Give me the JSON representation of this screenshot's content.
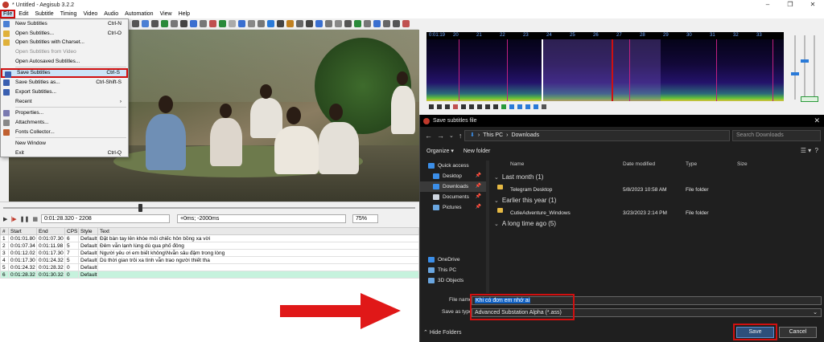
{
  "app": {
    "title": "* Untitled - Aegisub 3.2.2",
    "window_controls": [
      "–",
      "❐",
      "✕"
    ]
  },
  "menubar": [
    "File",
    "Edit",
    "Subtitle",
    "Timing",
    "Video",
    "Audio",
    "Automation",
    "View",
    "Help"
  ],
  "file_menu": [
    {
      "label": "New Subtitles",
      "shortcut": "Ctrl-N",
      "icon": "new-document-icon",
      "color": "#4a7fd4"
    },
    {
      "label": "Open Subtitles...",
      "shortcut": "Ctrl-O",
      "icon": "open-folder-icon",
      "color": "#e0b13a"
    },
    {
      "label": "Open Subtitles with Charset...",
      "shortcut": "",
      "icon": "open-charset-icon",
      "color": "#e0b13a"
    },
    {
      "label": "Open Subtitles from Video",
      "shortcut": "",
      "icon": "",
      "disabled": true
    },
    {
      "label": "Open Autosaved Subtitles...",
      "shortcut": "",
      "icon": ""
    },
    {
      "sep": true
    },
    {
      "label": "Save Subtitles",
      "shortcut": "Ctrl-S",
      "icon": "save-icon",
      "color": "#3a5fb0",
      "highlighted": true
    },
    {
      "label": "Save Subtitles as...",
      "shortcut": "Ctrl-Shift-S",
      "icon": "save-as-icon",
      "color": "#3a5fb0"
    },
    {
      "label": "Export Subtitles...",
      "shortcut": "",
      "icon": "export-icon",
      "color": "#3a5fb0"
    },
    {
      "label": "Recent",
      "shortcut": "›",
      "icon": ""
    },
    {
      "sep": true
    },
    {
      "label": "Properties...",
      "shortcut": "",
      "icon": "properties-icon",
      "color": "#7a7ab0"
    },
    {
      "label": "Attachments...",
      "shortcut": "",
      "icon": "attachment-icon",
      "color": "#888"
    },
    {
      "label": "Fonts Collector...",
      "shortcut": "",
      "icon": "fonts-icon",
      "color": "#c06030"
    },
    {
      "sep": true
    },
    {
      "label": "New Window",
      "shortcut": "",
      "icon": ""
    },
    {
      "label": "Exit",
      "shortcut": "Ctrl-Q",
      "icon": ""
    }
  ],
  "video_controls": {
    "time": "0:01:28.320 - 2208",
    "offset": "+0ms; -2000ms",
    "zoom": "75%"
  },
  "grid": {
    "headers": [
      "#",
      "Start",
      "End",
      "CPS",
      "Style",
      "Text"
    ],
    "rows": [
      [
        "1",
        "0:01:01.80",
        "0:01:07.30",
        "6",
        "Default",
        "Đặt bàn tay lên khóe môi chiếc hôn bồng xa vời"
      ],
      [
        "2",
        "0:01:07.34",
        "0:01:11.98",
        "5",
        "Default",
        "Đêm vẫn lạnh lùng dù qua phố đông"
      ],
      [
        "3",
        "0:01:12.02",
        "0:01:17.30",
        "7",
        "Default",
        "Người yêu ơi em biết không\\Nvẫn sâu đậm trong lòng"
      ],
      [
        "4",
        "0:01:17.30",
        "0:01:24.32",
        "5",
        "Default",
        "Dù thời gian trôi xa tình vẫn trao người thiết tha"
      ],
      [
        "5",
        "0:01:24.32",
        "0:01:28.32",
        "0",
        "Default",
        ""
      ],
      [
        "6",
        "0:01:28.32",
        "0:01:30.32",
        "0",
        "Default",
        ""
      ]
    ]
  },
  "audio": {
    "timeline_labels": [
      "0:01:19",
      "20",
      "21",
      "22",
      "23",
      "24",
      "25",
      "26",
      "27",
      "28",
      "29",
      "30",
      "31",
      "32",
      "33"
    ]
  },
  "dialog": {
    "title": "Save subtitles file",
    "path": [
      "This PC",
      "Downloads"
    ],
    "search_placeholder": "Search Downloads",
    "organize": "Organize ▾",
    "new_folder": "New folder",
    "nav_items": [
      {
        "label": "Quick access",
        "icon": "star-icon",
        "color": "#3b8ee8"
      },
      {
        "label": "Desktop",
        "icon": "desktop-icon",
        "color": "#3b8ee8",
        "pin": true
      },
      {
        "label": "Downloads",
        "icon": "download-icon",
        "color": "#3b8ee8",
        "pin": true,
        "selected": true
      },
      {
        "label": "Documents",
        "icon": "documents-icon",
        "color": "#cfd6e0",
        "pin": true
      },
      {
        "label": "Pictures",
        "icon": "pictures-icon",
        "color": "#6aa6e0",
        "pin": true
      },
      {
        "label": "",
        "icon": ""
      },
      {
        "label": "",
        "icon": ""
      },
      {
        "label": "",
        "icon": ""
      },
      {
        "label": "",
        "icon": ""
      },
      {
        "label": "OneDrive",
        "icon": "cloud-icon",
        "color": "#3b8ee8"
      },
      {
        "label": "This PC",
        "icon": "computer-icon",
        "color": "#6aa6e0"
      },
      {
        "label": "3D Objects",
        "icon": "cube-icon",
        "color": "#6aa6e0"
      }
    ],
    "columns": [
      "Name",
      "Date modified",
      "Type",
      "Size"
    ],
    "groups": [
      {
        "label": "Last month (1)",
        "files": [
          {
            "name": "Telegram Desktop",
            "date": "5/8/2023 10:58 AM",
            "type": "File folder"
          }
        ]
      },
      {
        "label": "Earlier this year (1)",
        "files": [
          {
            "name": "CutieAdventure_Windows",
            "date": "3/23/2023 2:14 PM",
            "type": "File folder"
          }
        ]
      },
      {
        "label": "A long time ago (5)",
        "files": []
      }
    ],
    "file_name_label": "File name:",
    "file_name_value": "Khi có đơn em nhớ ai",
    "save_type_label": "Save as type:",
    "save_type_value": "Advanced Substation Alpha (*.ass)",
    "hide_folders": "Hide Folders",
    "save_button": "Save",
    "cancel_button": "Cancel"
  },
  "colors": {
    "highlight_red": "#d01010",
    "selection_blue": "#1463c4",
    "active_row": "#c6f2dd"
  }
}
